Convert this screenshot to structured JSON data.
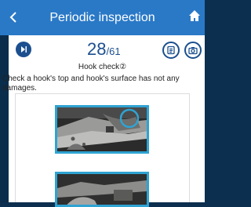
{
  "header": {
    "back_icon": "chevron-left-icon",
    "title": "Periodic inspection",
    "home_icon": "home-icon",
    "color": "#2a79c7"
  },
  "nav": {
    "skip_icon": "skip-forward-icon",
    "current": "28",
    "total": "/61",
    "note_icon": "note-icon",
    "camera_icon": "camera-icon",
    "accent": "#1b4f8f"
  },
  "check": {
    "title": "Hook check②",
    "description": "Check a hook's top and hook's surface has not any damages."
  },
  "photos": {
    "highlight_color": "#2fa3d2",
    "items": [
      "hook-top-photo",
      "hook-surface-photo"
    ]
  }
}
